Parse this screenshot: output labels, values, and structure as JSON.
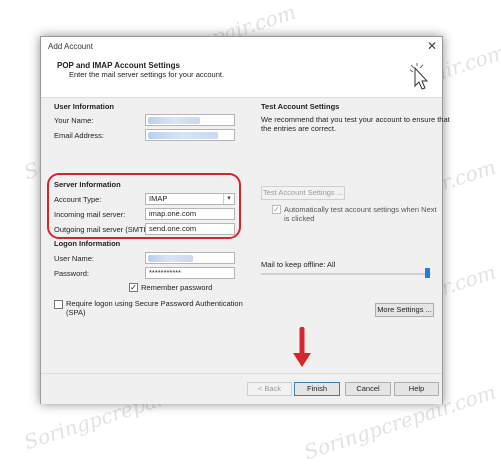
{
  "window": {
    "title": "Add Account",
    "close_glyph": "✕"
  },
  "header": {
    "title": "POP and IMAP Account Settings",
    "subtitle": "Enter the mail server settings for your account."
  },
  "user_info": {
    "heading": "User Information",
    "your_name_label": "Your Name:",
    "email_label": "Email Address:"
  },
  "server_info": {
    "heading": "Server Information",
    "account_type_label": "Account Type:",
    "account_type_value": "IMAP",
    "incoming_label": "Incoming mail server:",
    "incoming_value": "imap.one.com",
    "outgoing_label": "Outgoing mail server (SMTP):",
    "outgoing_value": "send.one.com"
  },
  "logon_info": {
    "heading": "Logon Information",
    "username_label": "User Name:",
    "password_label": "Password:",
    "password_value": "***********",
    "remember_label": "Remember password",
    "remember_checked": true,
    "spa_label_line1": "Require logon using Secure Password Authentication",
    "spa_label_line2": "(SPA)",
    "spa_checked": false
  },
  "test": {
    "heading": "Test Account Settings",
    "desc_line1": "We recommend that you test your account to ensure that",
    "desc_line2": "the entries are correct.",
    "button_label": "Test Account Settings ...",
    "auto_label_line1": "Automatically test account settings when Next",
    "auto_label_line2": "is clicked",
    "auto_checked": true
  },
  "offline": {
    "label": "Mail to keep offline:",
    "value": "All"
  },
  "more_settings_label": "More Settings ...",
  "footer": {
    "back_label": "< Back",
    "finish_label": "Finish",
    "cancel_label": "Cancel",
    "help_label": "Help"
  },
  "watermark": "Soringpcrepair.com",
  "colors": {
    "accent": "#2a7bd5",
    "annotation_red": "#d6262b"
  }
}
